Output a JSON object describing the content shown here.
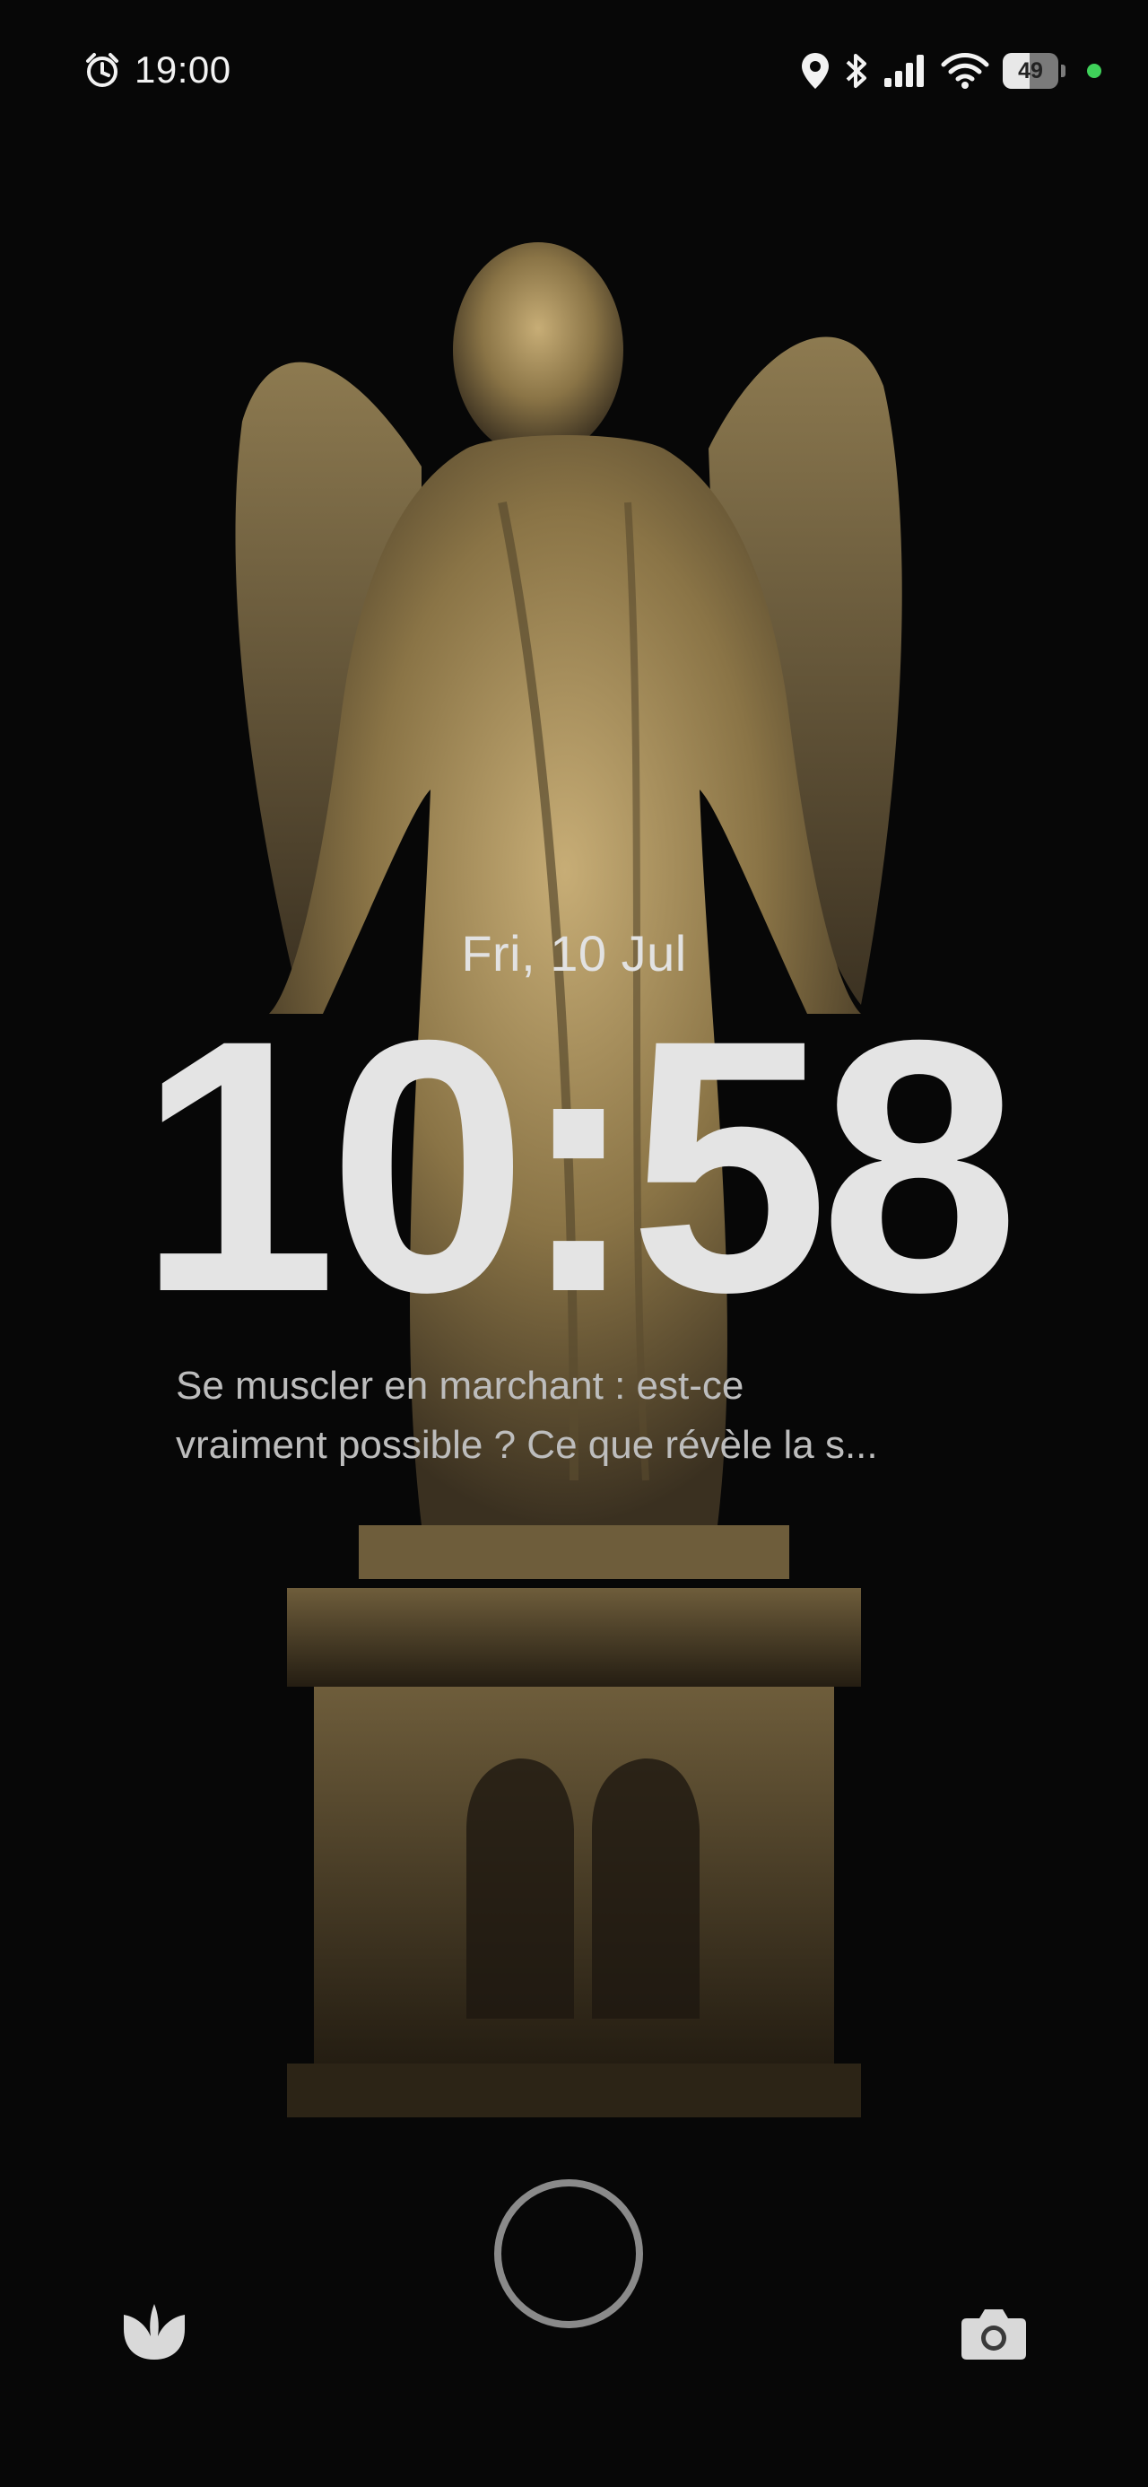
{
  "status_bar": {
    "time": "19:00",
    "icons": [
      "alarm-icon",
      "location-icon",
      "bluetooth-icon",
      "signal-icon",
      "wifi-icon"
    ],
    "battery_level": "49",
    "privacy_indicator_color": "#3fd15a"
  },
  "lock_screen": {
    "date": "Fri, 10 Jul",
    "time": "10:58",
    "notification": {
      "line1": "Se muscler en marchant : est-ce",
      "line2": "vraiment possible ? Ce que révèle la s..."
    }
  },
  "bottom_bar": {
    "left_shortcut_icon": "tulip-icon",
    "right_shortcut_icon": "camera-icon"
  },
  "colors": {
    "background": "#070707",
    "statue": "#8a7446",
    "text": "#e4e4e4"
  }
}
